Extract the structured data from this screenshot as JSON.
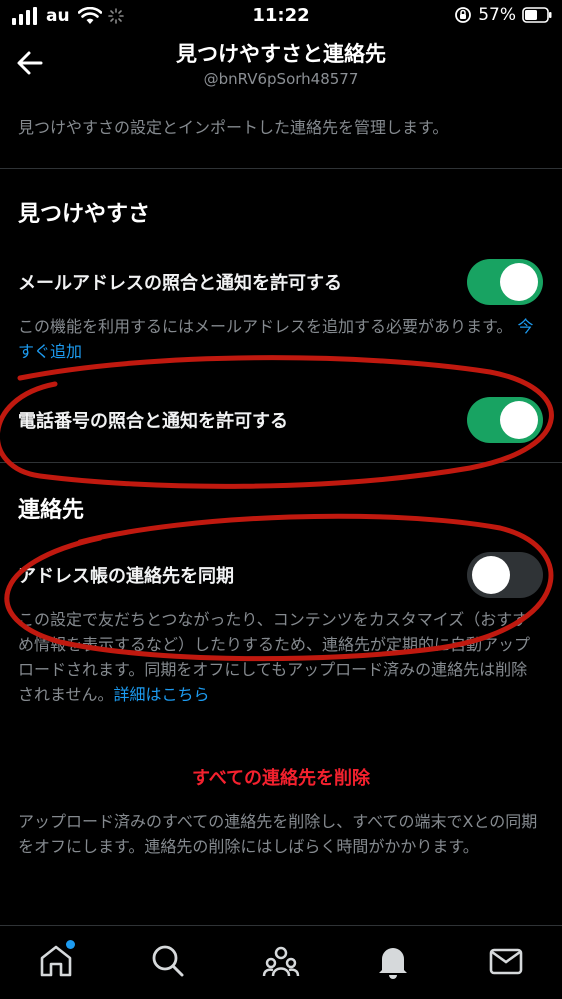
{
  "status_bar": {
    "carrier": "au",
    "time": "11:22",
    "battery": "57%"
  },
  "header": {
    "title": "見つけやすさと連絡先",
    "handle": "@bnRV6pSorh48577"
  },
  "intro": "見つけやすさの設定とインポートした連絡先を管理します。",
  "discoverability": {
    "title": "見つけやすさ",
    "email_setting": {
      "label": "メールアドレスの照合と通知を許可する",
      "enabled": true,
      "description": "この機能を利用するにはメールアドレスを追加する必要があります。",
      "link": "今すぐ追加"
    },
    "phone_setting": {
      "label": "電話番号の照合と通知を許可する",
      "enabled": true
    }
  },
  "contacts": {
    "title": "連絡先",
    "sync_setting": {
      "label": "アドレス帳の連絡先を同期",
      "enabled": false,
      "description": "この設定で友だちとつながったり、コンテンツをカスタマイズ（おすすめ情報を表示するなど）したりするため、連絡先が定期的に自動アップロードされます。同期をオフにしてもアップロード済みの連絡先は削除されません。",
      "link": "詳細はこちら"
    },
    "delete_all": {
      "label": "すべての連絡先を削除",
      "description": "アップロード済みのすべての連絡先を削除し、すべての端末でXとの同期をオフにします。連絡先の削除にはしばらく時間がかかります。"
    }
  },
  "tab_bar": {
    "tabs": [
      "home-icon",
      "search-icon",
      "communities-icon",
      "notifications-icon",
      "messages-icon"
    ],
    "home_has_dot": true
  },
  "colors": {
    "background": "#000000",
    "toggle_on": "#18a362",
    "link": "#1d9bf0",
    "danger": "#f4212e",
    "annotation": "#c0190f"
  }
}
